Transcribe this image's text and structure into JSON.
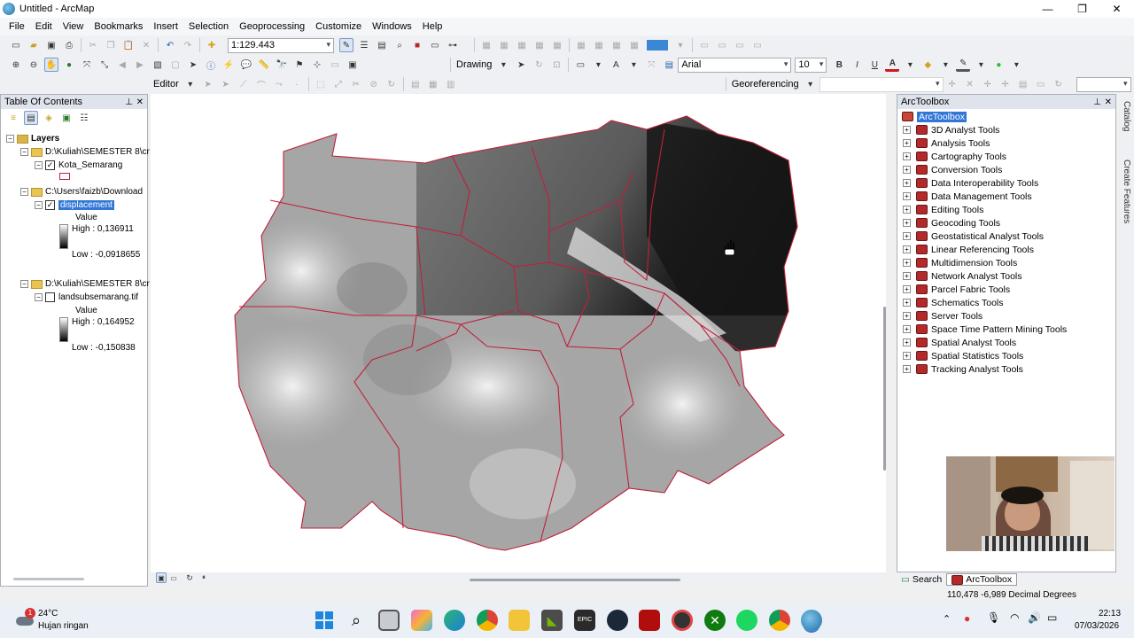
{
  "window": {
    "title": "Untitled - ArcMap",
    "minimize": "—",
    "maximize": "❐",
    "close": "✕"
  },
  "menu": [
    "File",
    "Edit",
    "View",
    "Bookmarks",
    "Insert",
    "Selection",
    "Geoprocessing",
    "Customize",
    "Windows",
    "Help"
  ],
  "toolbar": {
    "scale": "1:129.443",
    "drawing_label": "Drawing",
    "font_name": "Arial",
    "font_size": "10",
    "bold": "B",
    "italic": "I",
    "underline": "U",
    "text_tool": "A",
    "font_color_glyph": "A",
    "editor_label": "Editor",
    "georef_label": "Georeferencing"
  },
  "toc": {
    "title": "Table Of Contents",
    "pin": "⊥",
    "close": "✕",
    "layers_label": "Layers",
    "groups": [
      {
        "path": "D:\\Kuliah\\SEMESTER 8\\cr",
        "layer": "Kota_Semarang",
        "checked": true
      },
      {
        "path": "C:\\Users\\faizb\\Download",
        "layer": "displacement",
        "checked": true,
        "legend_title": "Value",
        "high": "High : 0,136911",
        "low": "Low : -0,0918655"
      },
      {
        "path": "D:\\Kuliah\\SEMESTER 8\\cr",
        "layer": "landsubsemarang.tif",
        "checked": false,
        "legend_title": "Value",
        "high": "High : 0,164952",
        "low": "Low : -0,150838"
      }
    ]
  },
  "arctoolbox": {
    "title": "ArcToolbox",
    "root": "ArcToolbox",
    "tools": [
      "3D Analyst Tools",
      "Analysis Tools",
      "Cartography Tools",
      "Conversion Tools",
      "Data Interoperability Tools",
      "Data Management Tools",
      "Editing Tools",
      "Geocoding Tools",
      "Geostatistical Analyst Tools",
      "Linear Referencing Tools",
      "Multidimension Tools",
      "Network Analyst Tools",
      "Parcel Fabric Tools",
      "Schematics Tools",
      "Server Tools",
      "Space Time Pattern Mining Tools",
      "Spatial Analyst Tools",
      "Spatial Statistics Tools",
      "Tracking Analyst Tools"
    ],
    "tab_search": "Search",
    "tab_arctoolbox": "ArcToolbox"
  },
  "side_tabs": {
    "catalog": "Catalog",
    "create_features": "Create Features"
  },
  "status": {
    "coords": "110,478  -6,989 Decimal Degrees"
  },
  "taskbar": {
    "weather_temp": "24°C",
    "weather_desc": "Hujan ringan",
    "weather_badge": "1",
    "time": "22:13",
    "date": "07/03/2026"
  }
}
